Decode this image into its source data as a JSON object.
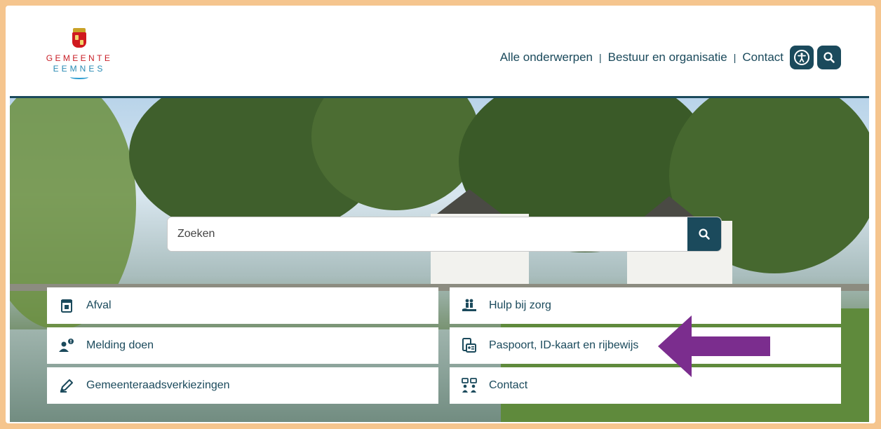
{
  "header": {
    "logo": {
      "line1": "GEMEENTE",
      "line2": "EEMNES",
      "icon": "municipal-crest"
    },
    "nav": [
      {
        "label": "Alle onderwerpen"
      },
      {
        "label": "Bestuur en organisatie"
      },
      {
        "label": "Contact"
      }
    ],
    "accessibility_icon": "accessibility-icon",
    "search_icon": "search-icon"
  },
  "search": {
    "placeholder": "Zoeken",
    "value": ""
  },
  "tiles": [
    {
      "label": "Afval",
      "icon": "trash-bin-icon"
    },
    {
      "label": "Hulp bij zorg",
      "icon": "care-hands-icon"
    },
    {
      "label": "Melding doen",
      "icon": "person-alert-icon"
    },
    {
      "label": "Paspoort, ID-kaart en rijbewijs",
      "icon": "id-card-icon"
    },
    {
      "label": "Gemeenteraadsverkiezingen",
      "icon": "pencil-ballot-icon"
    },
    {
      "label": "Contact",
      "icon": "people-chat-icon"
    }
  ],
  "colors": {
    "primary": "#1b4a5c",
    "frame": "#f5c58e",
    "annotation_arrow": "#7b2d8e",
    "logo_red": "#c81e26",
    "logo_blue": "#2a8bb4"
  }
}
